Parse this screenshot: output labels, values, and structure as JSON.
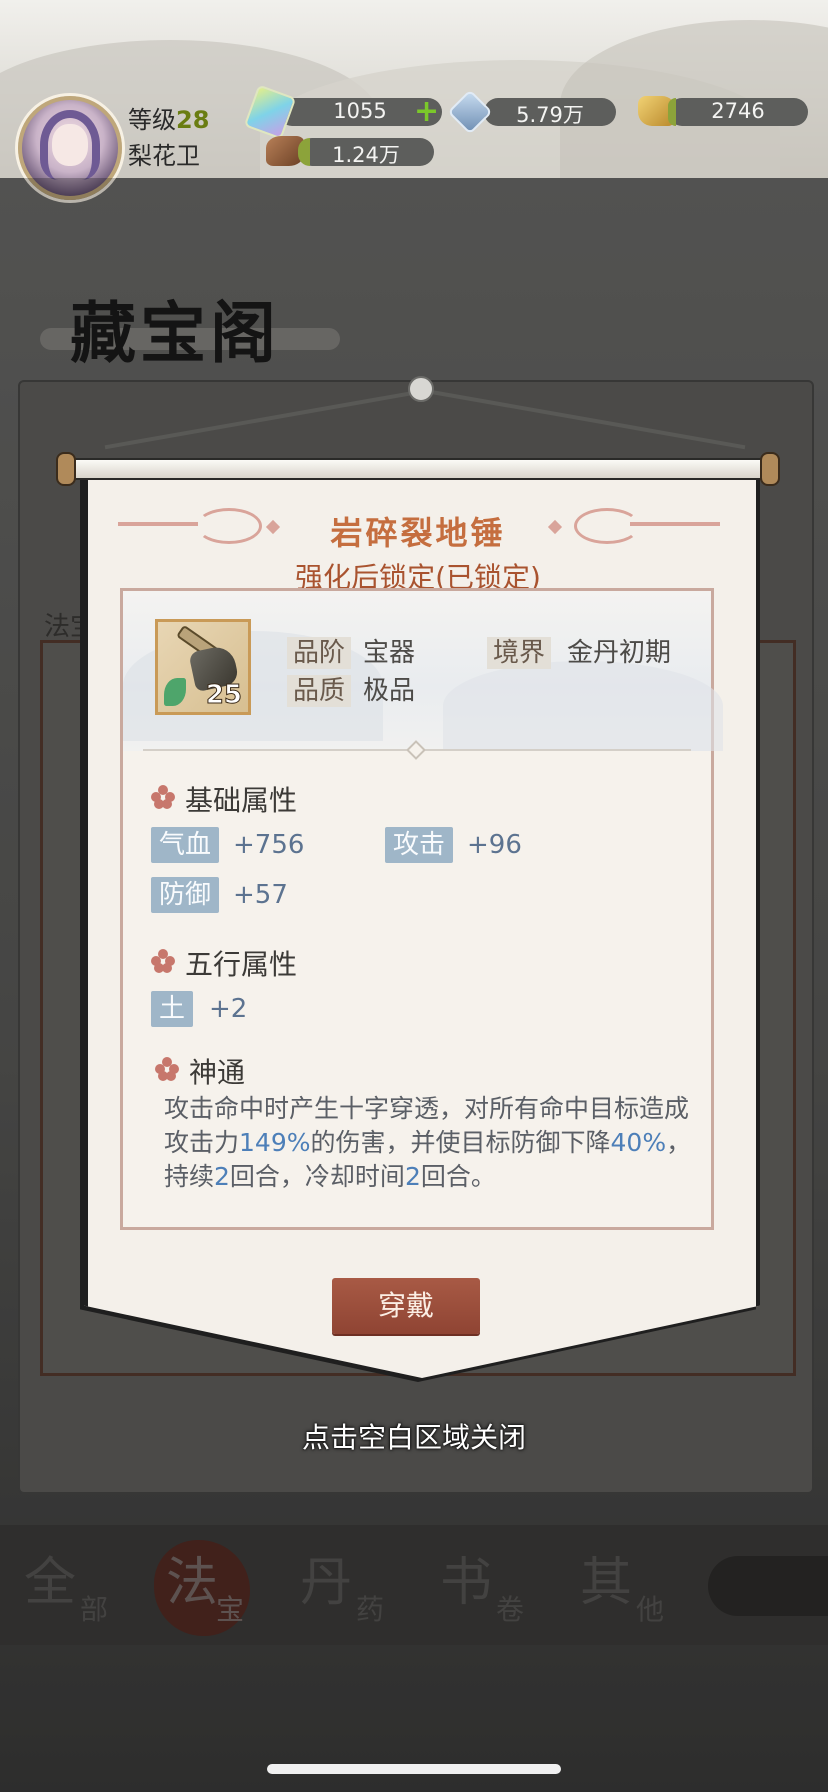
{
  "player": {
    "level_label": "等级",
    "level": "28",
    "name": "梨花卫"
  },
  "resources": {
    "rainbow_gem": "1055",
    "blue_gem": "5.79万",
    "gold": "2746",
    "wood": "1.24万"
  },
  "background": {
    "page_title": "藏宝阁",
    "section_label": "法宝",
    "tabs": [
      {
        "big": "全",
        "small": "部"
      },
      {
        "big": "法",
        "small": "宝"
      },
      {
        "big": "丹",
        "small": "药"
      },
      {
        "big": "书",
        "small": "卷"
      },
      {
        "big": "其",
        "small": "他"
      }
    ]
  },
  "item": {
    "name": "岩碎裂地锤",
    "lock_status": "强化后锁定(已锁定)",
    "level": "25",
    "grade_label": "品阶",
    "grade_value": "宝器",
    "realm_label": "境界",
    "realm_value": "金丹初期",
    "quality_label": "品质",
    "quality_value": "极品",
    "base_attr_title": "基础属性",
    "base_attrs": [
      {
        "name": "气血",
        "value": "+756"
      },
      {
        "name": "攻击",
        "value": "+96"
      },
      {
        "name": "防御",
        "value": "+57"
      }
    ],
    "element_attr_title": "五行属性",
    "element_attrs": [
      {
        "name": "土",
        "value": "+2"
      }
    ],
    "skill_title": "神通",
    "skill_desc": {
      "p1": "攻击命中时产生十字穿透，对所有命中目标造成攻击力",
      "v1": "149%",
      "p2": "的伤害，并使目标防御下降",
      "v2": "40%",
      "p3": "，持续",
      "v3": "2",
      "p4": "回合，冷却时间",
      "v4": "2",
      "p5": "回合。"
    },
    "wear_button": "穿戴"
  },
  "close_hint": "点击空白区域关闭",
  "colors": {
    "title": "#c56e3f",
    "accent_blue": "#4d7fb8",
    "button": "#8f4433"
  }
}
